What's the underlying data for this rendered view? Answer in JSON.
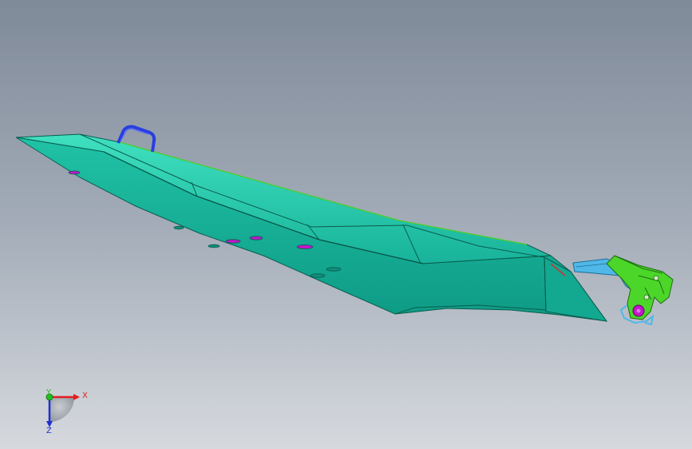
{
  "viewport": {
    "background_top": "#7f8a99",
    "background_bottom": "#d6d9de"
  },
  "model": {
    "hull_color": "#22c4a8",
    "hull_dark": "#0f8f7d",
    "handle_color": "#2a3fe0",
    "bracket_color": "#4fb8e8",
    "mount_color": "#4cd62a",
    "hole_color": "#c018c8"
  },
  "triad": {
    "x_label": "X",
    "y_label": "Y",
    "z_label": "Z",
    "x_color": "#e02020",
    "y_color": "#20c020",
    "z_color": "#2030d0"
  }
}
